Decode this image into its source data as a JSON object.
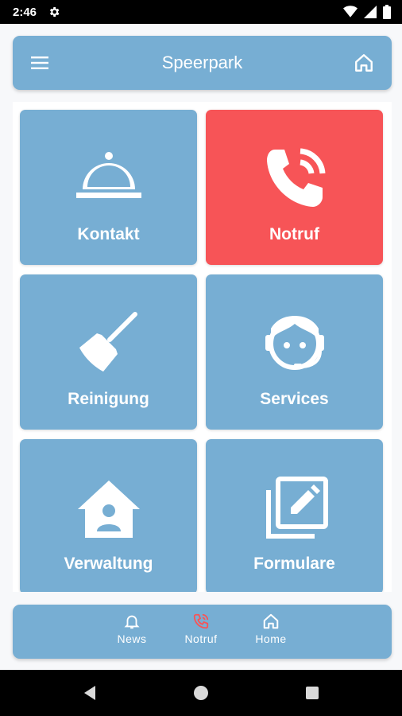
{
  "status_bar": {
    "time": "2:46",
    "icons": [
      "settings-gear-icon",
      "wifi-icon",
      "cell-signal-icon",
      "battery-icon"
    ]
  },
  "app_bar": {
    "title": "Speerpark",
    "menu_icon": "hamburger-menu-icon",
    "home_icon": "home-icon"
  },
  "tiles": [
    {
      "label": "Kontakt",
      "icon": "cloche-icon",
      "color": "#77aed3"
    },
    {
      "label": "Notruf",
      "icon": "phone-ringing-icon",
      "color": "#f75457"
    },
    {
      "label": "Reinigung",
      "icon": "broom-icon",
      "color": "#77aed3"
    },
    {
      "label": "Services",
      "icon": "support-agent-icon",
      "color": "#77aed3"
    },
    {
      "label": "Verwaltung",
      "icon": "house-person-icon",
      "color": "#77aed3"
    },
    {
      "label": "Formulare",
      "icon": "edit-documents-icon",
      "color": "#77aed3"
    }
  ],
  "bottom_nav": {
    "items": [
      {
        "label": "News",
        "icon": "bell-icon"
      },
      {
        "label": "Notruf",
        "icon": "phone-ringing-icon",
        "icon_color": "#f75457"
      },
      {
        "label": "Home",
        "icon": "home-icon"
      }
    ]
  },
  "colors": {
    "primary": "#77aed3",
    "alert": "#f75457",
    "background": "#f7f8fa"
  }
}
